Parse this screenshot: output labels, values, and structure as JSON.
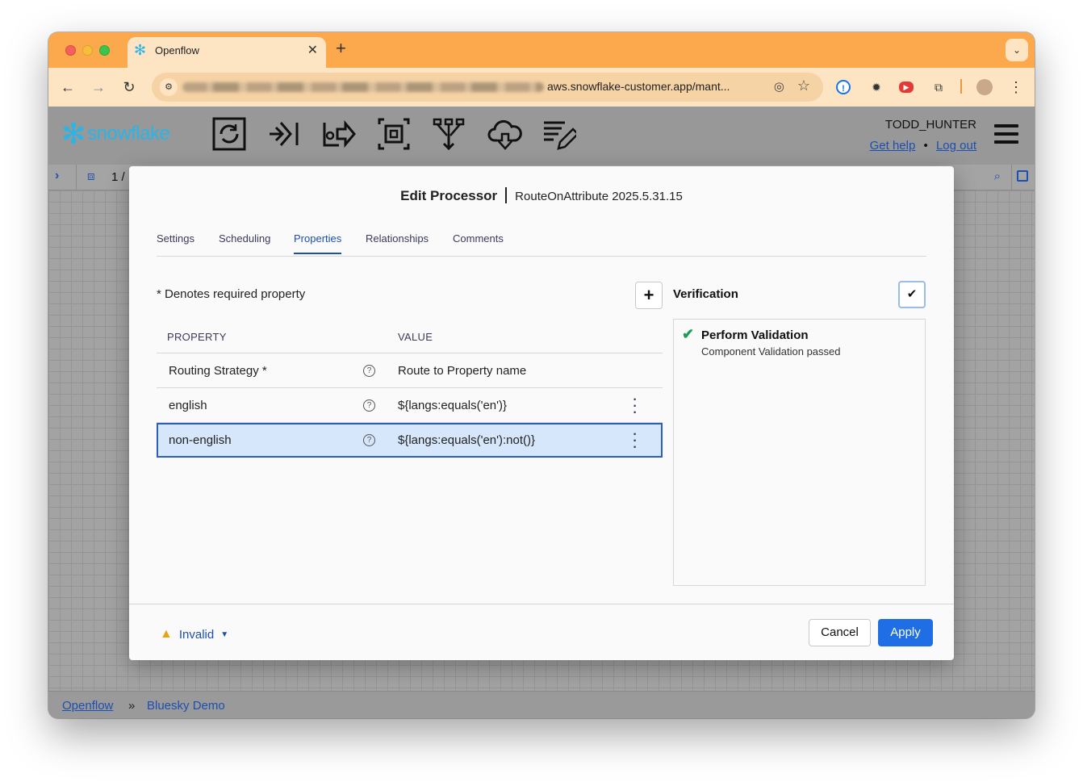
{
  "browser": {
    "tab_title": "Openflow",
    "url_visible": "aws.snowflake-customer.app/mant..."
  },
  "app": {
    "logo_text": "snowflake",
    "user_name": "TODD_HUNTER",
    "get_help": "Get help",
    "separator": "•",
    "log_out": "Log out",
    "group_count": "1 /"
  },
  "dialog": {
    "title": "Edit Processor",
    "subtitle": "RouteOnAttribute 2025.5.31.15",
    "tabs": [
      {
        "label": "Settings"
      },
      {
        "label": "Scheduling"
      },
      {
        "label": "Properties"
      },
      {
        "label": "Relationships"
      },
      {
        "label": "Comments"
      }
    ],
    "active_tab": "Properties",
    "required_note": "* Denotes required property",
    "add_label": "+",
    "columns": {
      "property": "PROPERTY",
      "value": "VALUE"
    },
    "rows": [
      {
        "name": "Routing Strategy *",
        "value": "Route to Property name"
      },
      {
        "name": "english",
        "value": "${langs:equals('en')}"
      },
      {
        "name": "non-english",
        "value": "${langs:equals('en'):not()}"
      }
    ],
    "verification": {
      "title": "Verification",
      "check_label": "Perform Validation",
      "detail": "Component Validation passed"
    },
    "footer": {
      "status": "Invalid",
      "cancel": "Cancel",
      "apply": "Apply"
    }
  },
  "breadcrumb": {
    "root": "Openflow",
    "sep": "»",
    "current": "Bluesky Demo"
  },
  "colors": {
    "tab_bar": "#fba94c",
    "accent": "#1b4fb3",
    "primary_button": "#1f6ee5",
    "success": "#1f9d55",
    "warning": "#e8a317",
    "selected_row": "#d6e6fb"
  }
}
